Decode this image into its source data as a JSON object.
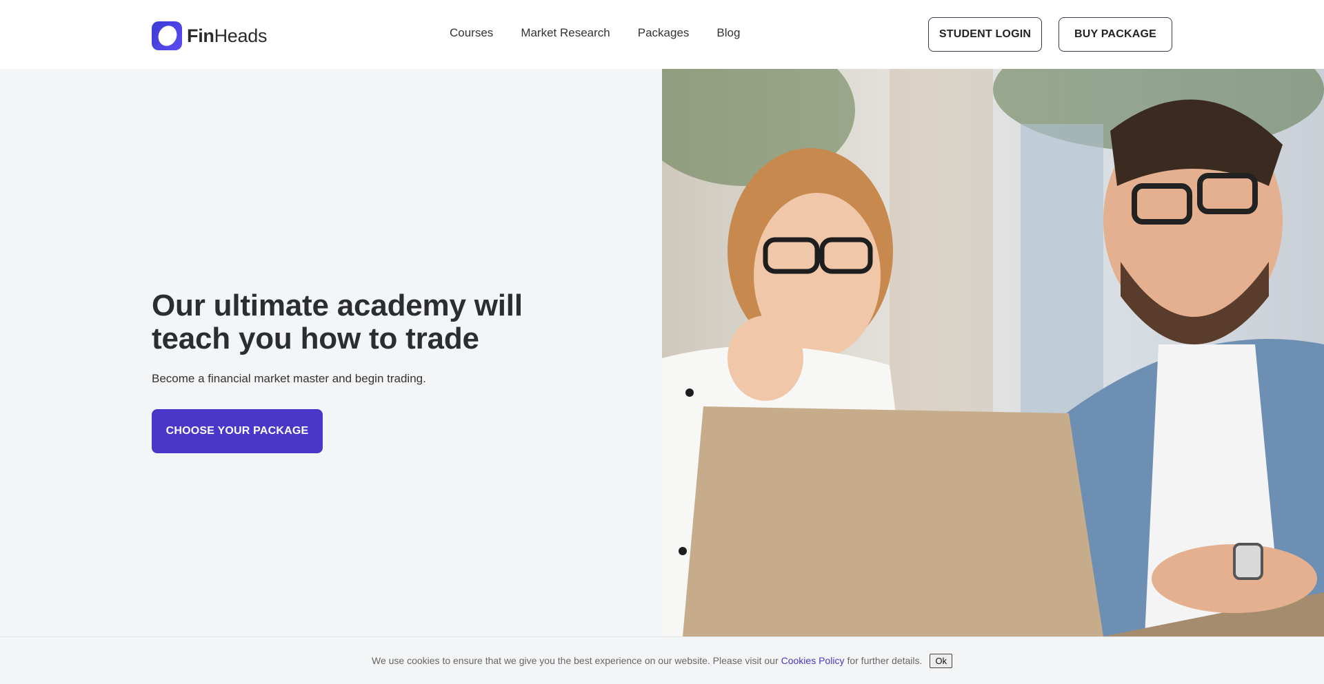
{
  "brand": {
    "name_bold": "Fin",
    "name_regular": "Heads",
    "accent_color": "#4a36c8"
  },
  "nav": {
    "items": [
      {
        "label": "Courses"
      },
      {
        "label": "Market Research"
      },
      {
        "label": "Packages"
      },
      {
        "label": "Blog"
      }
    ]
  },
  "header_buttons": {
    "login_label": "STUDENT LOGIN",
    "buy_label": "BUY PACKAGE"
  },
  "hero": {
    "title": "Our ultimate academy will teach you how to trade",
    "subtitle": "Become a financial market master and begin trading.",
    "cta_label": "CHOOSE YOUR PACKAGE",
    "image_icon": "photo-two-people-laptop"
  },
  "cookie": {
    "text_before": "We use cookies to ensure that we give you the best experience on our website. Please visit our",
    "link_label": "Cookies Policy",
    "text_after": "for further details.",
    "ok_label": "Ok"
  }
}
